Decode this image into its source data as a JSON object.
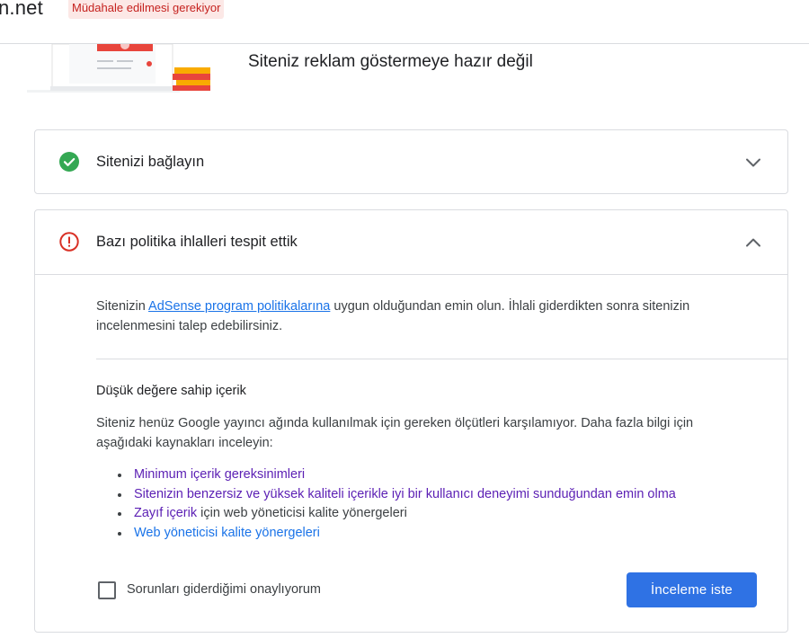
{
  "header": {
    "site_name": "n.net",
    "status_badge": "Müdahale edilmesi gerekiyor"
  },
  "hero": {
    "title": "Siteniz reklam göstermeye hazır değil"
  },
  "connect_card": {
    "title": "Sitenizi bağlayın",
    "status": "completed",
    "expanded": false
  },
  "policy_card": {
    "title": "Bazı politika ihlalleri tespit ettik",
    "status": "error",
    "expanded": true,
    "intro_before": "Sitenizin ",
    "intro_link": "AdSense program politikalarına",
    "intro_after": " uygun olduğundan emin olun. İhlali giderdikten sonra sitenizin incelenmesini talep edebilirsiniz.",
    "section_title": "Düşük değere sahip içerik",
    "section_desc": "Siteniz henüz Google yayıncı ağında kullanılmak için gereken ölçütleri karşılamıyor. Daha fazla bilgi için aşağıdaki kaynakları inceleyin:",
    "resources": [
      {
        "link": "Minimum içerik gereksinimleri",
        "suffix": ""
      },
      {
        "link": "Sitenizin benzersiz ve yüksek kaliteli içerikle iyi bir kullanıcı deneyimi sunduğundan emin olma",
        "suffix": ""
      },
      {
        "link": "Zayıf içerik",
        "suffix": " için web yöneticisi kalite yönergeleri"
      },
      {
        "link": "Web yöneticisi kalite yönergeleri",
        "suffix": ""
      }
    ],
    "confirm_label": "Sorunları giderdiğimi onaylıyorum",
    "confirm_checked": false,
    "review_button": "İnceleme iste"
  },
  "colors": {
    "success": "#34a853",
    "error": "#d93025",
    "primary": "#1a73e8",
    "visited_link": "#5b1fb4"
  },
  "icons": [
    "check-circle-icon",
    "error-circle-icon",
    "chevron-down-icon",
    "chevron-up-icon"
  ]
}
